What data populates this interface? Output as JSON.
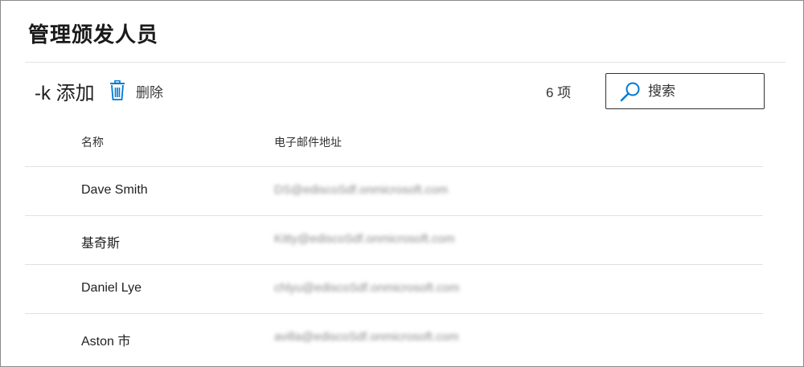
{
  "panel": {
    "title": "管理颁发人员"
  },
  "toolbar": {
    "add_label": "-k 添加",
    "delete_label": "删除",
    "item_count": "6 项",
    "search_placeholder": "搜索"
  },
  "table": {
    "columns": [
      "名称",
      "电子邮件地址"
    ],
    "rows": [
      {
        "name": "Dave Smith",
        "email": "DS@ediscoSdf.onmicrosoft.com"
      },
      {
        "name": "基奇斯",
        "email": "Kitty@ediscoSdf.onmicrosoft.com"
      },
      {
        "name": "Daniel Lye",
        "email": "chlyu@ediscoSdf.onmicrosoft.com"
      },
      {
        "name": "Aston 市",
        "email": "avilla@ediscoSdf.onmicrosoft.com"
      }
    ]
  },
  "colors": {
    "accent": "#0078d4",
    "divider": "#e1e1e1",
    "border": "#8a8a8a"
  },
  "icons": {
    "delete": "trash-icon",
    "search": "search-icon"
  }
}
